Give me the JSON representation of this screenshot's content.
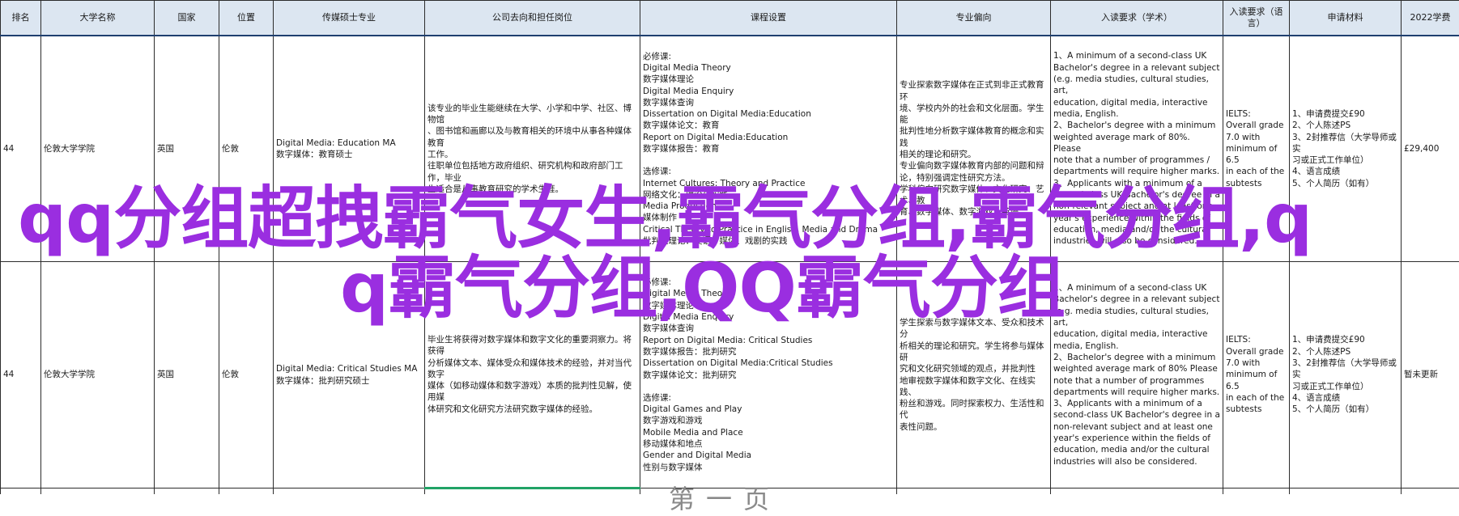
{
  "headers": [
    "排名",
    "大学名称",
    "国家",
    "位置",
    "传媒硕士专业",
    "公司去向和担任岗位",
    "课程设置",
    "专业偏向",
    "入读要求（学术）",
    "入读要求（语言）",
    "申请材料",
    "2022学费"
  ],
  "rows": [
    {
      "rank": "44",
      "university": "伦敦大学学院",
      "country": "英国",
      "city": "伦敦",
      "major": [
        "Digital Media: Education MA",
        "数字媒体：教育硕士"
      ],
      "career": [
        "该专业的毕业生能继续在大学、小学和中学、社区、博物馆",
        "、图书馆和画廊以及与教育相关的环境中从事各种媒体教育",
        "工作。",
        "往职单位包括地方政府组织、研究机构和政府部门工作，毕业",
        "生适合是从事教育研究的学术生涯。"
      ],
      "courses_required": [
        "必修课:",
        "Digital Media Theory",
        "数字媒体理论",
        "Digital Media Enquiry",
        "数字媒体查询",
        "Dissertation on Digital Media:Education",
        "数字媒体论文：教育",
        "Report on Digital Media:Education",
        "数字媒体报告：教育"
      ],
      "courses_elective": [
        "选修课:",
        "Internet Cultures: Theory and Practice",
        "网络文化：理论与实践",
        "Media Production",
        "媒体制作",
        "Critical Theory to Practice in English, Media and Drama",
        "批判性理论：英语、媒体、戏剧的实践"
      ],
      "focus": [
        "专业探索数字媒体在正式到非正式教育环",
        "境、学校内外的社会和文化层面。学生能",
        "批判性地分析数字媒体教育的概念和实践",
        "相关的理论和研究。",
        "专业偏向数字媒体教育内部的问题和辩",
        "论，特别强调定性研究方法。",
        "学科偏向研究数字媒体、文化研究、艺术、教",
        "育、数字媒体、数字游戏、英语"
      ],
      "academic": [
        "1、A minimum of a second-class UK",
        "Bachelor's degree in a relevant subject",
        "(e.g. media studies, cultural studies, art,",
        "education, digital media, interactive",
        "media, English.",
        "2、Bachelor's degree with a minimum",
        "weighted average mark of 80%. Please",
        "note that a number of programmes /",
        "departments will require higher marks.",
        "3、Applicants with a minimum of a",
        "second-class UK Bachelor's degree in a",
        "non-relevant subject and at least one",
        "year's experience within the fields of",
        "education, media and/or the cultural",
        "industries will also be considered."
      ],
      "language": [
        "IELTS:",
        "Overall grade",
        "7.0 with",
        "minimum of 6.5",
        "in each of the",
        "subtests"
      ],
      "materials": [
        "1、申请费提交£90",
        "2、个人陈述PS",
        "3、2封推荐信（大学导师或实",
        "习或正式工作单位）",
        "4、语言成绩",
        "5、个人简历（如有）"
      ],
      "tuition": "£29,400"
    },
    {
      "rank": "44",
      "university": "伦敦大学学院",
      "country": "英国",
      "city": "伦敦",
      "major": [
        "Digital Media: Critical Studies MA",
        "数字媒体：批判研究硕士"
      ],
      "career": [
        "毕业生将获得对数字媒体和数字文化的重要洞察力。将获得",
        "分析媒体文本、媒体受众和媒体技术的经验，并对当代数字",
        "媒体（如移动媒体和数字游戏）本质的批判性见解，使用媒",
        "体研究和文化研究方法研究数字媒体的经验。"
      ],
      "courses_required": [
        "必修课:",
        "Digital Media Theory",
        "数字媒体理论",
        "Digital Media Enquiry",
        "数字媒体查询",
        "Report on Digital Media: Critical Studies",
        "数字媒体报告：批判研究",
        "Dissertation on Digital Media:Critical Studies",
        "数字媒体论文：批判研究"
      ],
      "courses_elective": [
        "选修课:",
        "Digital Games and Play",
        "数字游戏和游戏",
        "Mobile Media and Place",
        "移动媒体和地点",
        "Gender and Digital Media",
        "性别与数字媒体"
      ],
      "focus": [
        "学生探索与数字媒体文本、受众和技术分",
        "析相关的理论和研究。学生将参与媒体研",
        "究和文化研究领域的观点，并批判性",
        "地审视数字媒体和数字文化、在线实践、",
        "粉丝和游戏。同时探索权力、生活性和代",
        "表性问题。"
      ],
      "academic": [
        "1、A minimum of a second-class UK",
        "Bachelor's degree in a relevant subject",
        "(e.g. media studies, cultural studies, art,",
        "education, digital media, interactive",
        "media, English.",
        "2、Bachelor's degree with a minimum",
        "weighted average mark of 80% Please",
        "note that a number of programmes",
        "departments will require higher marks.",
        "3、Applicants with a minimum of a",
        "second-class UK Bachelor's degree in a",
        "non-relevant subject and at least one",
        "year's experience within the fields of",
        "education, media and/or the cultural",
        "industries will also be considered."
      ],
      "language": [
        "IELTS:",
        "Overall grade",
        "7.0 with",
        "minimum of 6.5",
        "in each of the",
        "subtests"
      ],
      "materials": [
        "1、申请费提交£90",
        "2、个人陈述PS",
        "3、2封推荐信（大学导师或实",
        "习或正式工作单位）",
        "4、语言成绩",
        "5、个人简历（如有）"
      ],
      "tuition": "暂未更新"
    }
  ],
  "watermark": {
    "line1": "qq分组超拽霸气女生,霸气分组,霸气分组,q",
    "line2": "q霸气分组,QQ霸气分组"
  },
  "footer_ghost": "第一页"
}
